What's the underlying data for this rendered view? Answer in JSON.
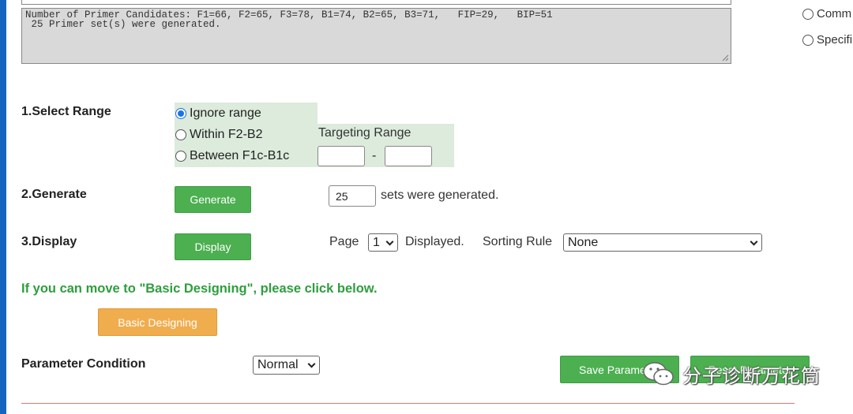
{
  "result_box": {
    "line1": "Number of Primer Candidates: F1=66, F2=65, F3=78, B1=74, B2=65, B3=71,   FIP=29,   BIP=51",
    "line2": " 25 Primer set(s) were generated."
  },
  "right_options": [
    {
      "label": "Comm"
    },
    {
      "label": "Specifi"
    }
  ],
  "select_range": {
    "title": "1.Select Range",
    "options": [
      {
        "label": "Ignore range",
        "checked": true
      },
      {
        "label": "Within F2-B2",
        "checked": false
      },
      {
        "label": "Between F1c-B1c",
        "checked": false
      }
    ],
    "targeting_label": "Targeting Range",
    "range_from": "",
    "range_to": "",
    "dash": "-"
  },
  "generate": {
    "title": "2.Generate",
    "button_label": "Generate",
    "count_value": "25",
    "suffix_text": "sets were generated."
  },
  "display": {
    "title": "3.Display",
    "button_label": "Display",
    "page_label": "Page",
    "page_value": "1",
    "displayed_text": "Displayed.",
    "sorting_label": "Sorting Rule",
    "sorting_value": "None"
  },
  "basic_note": "If you can move to \"Basic Designing\", please click below.",
  "basic_button_label": "Basic Designing",
  "parameter": {
    "title": "Parameter Condition",
    "select_value": "Normal",
    "save_button_label": "Save Parame",
    "reset_button_label": "Reset Parameter"
  },
  "watermark": {
    "text": "分子诊断万花筒",
    "icon": "wechat-icon"
  },
  "colors": {
    "accent_blue": "#1565c0",
    "button_green": "#4caf50",
    "button_orange": "#f0ad4e",
    "note_green": "#2e9e3e",
    "range_bg": "#dcebdc",
    "divider_red": "#e57373"
  }
}
